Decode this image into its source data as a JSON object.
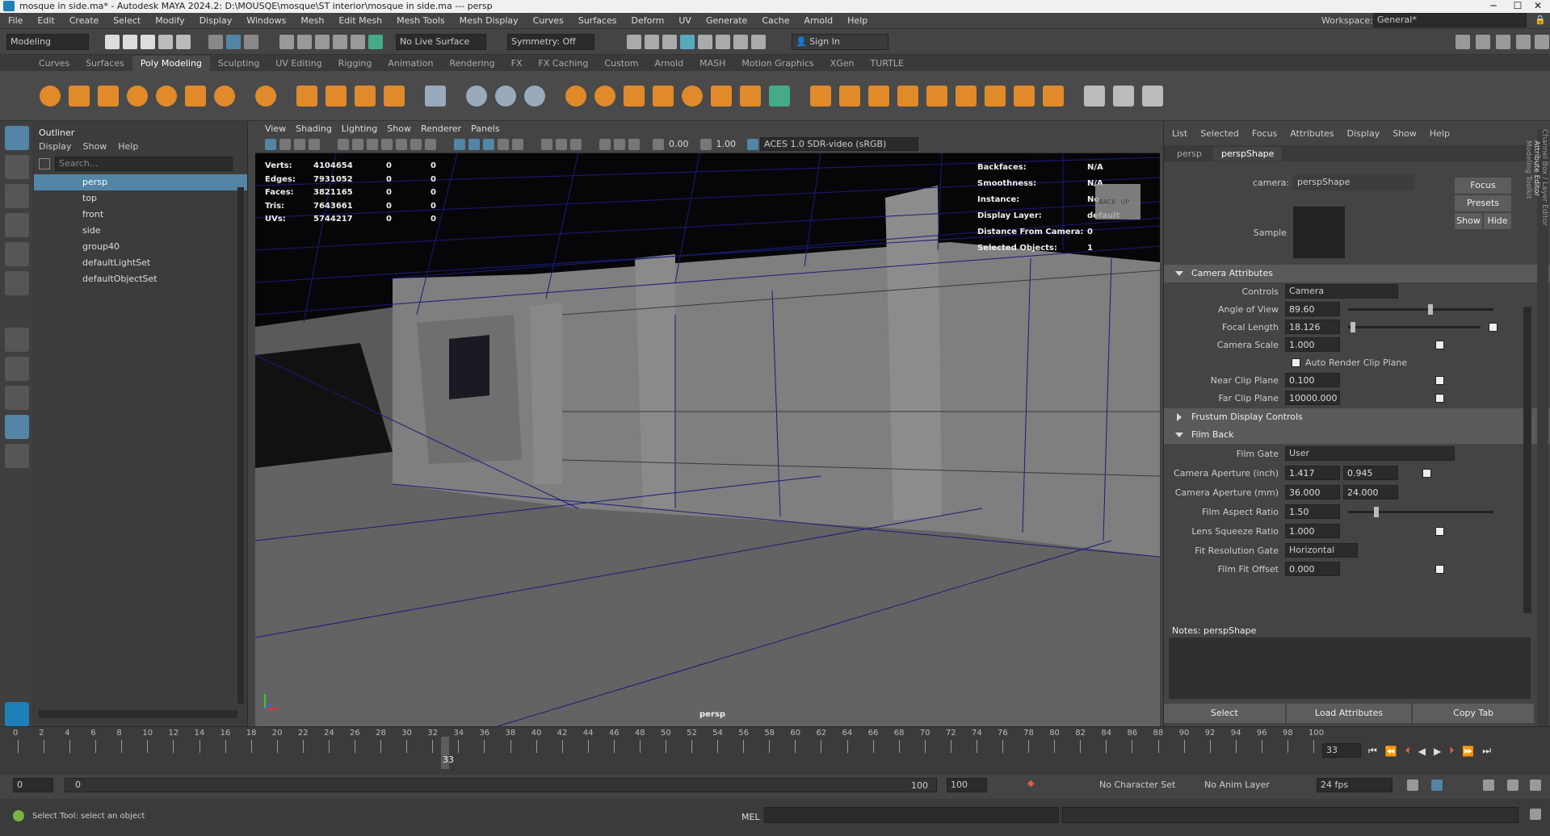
{
  "title": "mosque in side.ma* - Autodesk MAYA 2024.2: D:\\MOUSQE\\mosque\\ST interior\\mosque in side.ma   ---   persp",
  "menus": [
    "File",
    "Edit",
    "Create",
    "Select",
    "Modify",
    "Display",
    "Windows",
    "Mesh",
    "Edit Mesh",
    "Mesh Tools",
    "Mesh Display",
    "Curves",
    "Surfaces",
    "Deform",
    "UV",
    "Generate",
    "Cache",
    "Arnold",
    "Help"
  ],
  "workspace": {
    "label": "Workspace:",
    "value": "General*"
  },
  "status": {
    "mode": "Modeling",
    "live": "No Live Surface",
    "symmetry": "Symmetry: Off",
    "signin": "Sign In"
  },
  "shelf_tabs": [
    "Curves",
    "Surfaces",
    "Poly Modeling",
    "Sculpting",
    "UV Editing",
    "Rigging",
    "Animation",
    "Rendering",
    "FX",
    "FX Caching",
    "Custom",
    "Arnold",
    "MASH",
    "Motion Graphics",
    "XGen",
    "TURTLE"
  ],
  "outliner": {
    "title": "Outliner",
    "menu": [
      "Display",
      "Show",
      "Help"
    ],
    "search": "Search...",
    "items": [
      "persp",
      "top",
      "front",
      "side",
      "group40",
      "defaultLightSet",
      "defaultObjectSet"
    ]
  },
  "viewport": {
    "menu": [
      "View",
      "Shading",
      "Lighting",
      "Show",
      "Renderer",
      "Panels"
    ],
    "val1": "0.00",
    "val2": "1.00",
    "colorspace": "ACES 1.0 SDR-video (sRGB)",
    "camera": "persp",
    "hud_left": [
      [
        "Verts:",
        "4104654",
        "0",
        "0"
      ],
      [
        "Edges:",
        "7931052",
        "0",
        "0"
      ],
      [
        "Faces:",
        "3821165",
        "0",
        "0"
      ],
      [
        "Tris:",
        "7643661",
        "0",
        "0"
      ],
      [
        "UVs:",
        "5744217",
        "0",
        "0"
      ]
    ],
    "hud_right": [
      [
        "Backfaces:",
        "N/A"
      ],
      [
        "Smoothness:",
        "N/A"
      ],
      [
        "Instance:",
        "No"
      ],
      [
        "Display Layer:",
        "default"
      ],
      [
        "Distance From Camera:",
        "0"
      ],
      [
        "Selected Objects:",
        "1"
      ]
    ],
    "cube": [
      "BACK",
      "UP"
    ]
  },
  "ae": {
    "menu": [
      "List",
      "Selected",
      "Focus",
      "Attributes",
      "Display",
      "Show",
      "Help"
    ],
    "tabs": [
      "persp",
      "perspShape"
    ],
    "camera_label": "camera:",
    "camera_value": "perspShape",
    "focus": "Focus",
    "presets": "Presets",
    "show": "Show",
    "hide": "Hide",
    "sample": "Sample",
    "sec_camera": "Camera Attributes",
    "controls_label": "Controls",
    "controls_value": "Camera",
    "aov_label": "Angle of View",
    "aov": "89.60",
    "aov_frac": 0.55,
    "fl_label": "Focal Length",
    "fl": "18.126",
    "fl_frac": 0.02,
    "cs_label": "Camera Scale",
    "cs": "1.000",
    "auto_clip": "Auto Render Clip Plane",
    "near_label": "Near Clip Plane",
    "near": "0.100",
    "far_label": "Far Clip Plane",
    "far": "10000.000",
    "sec_frustum": "Frustum Display Controls",
    "sec_film": "Film Back",
    "fg_label": "Film Gate",
    "fg": "User",
    "ca_in_label": "Camera Aperture (inch)",
    "ca_in_1": "1.417",
    "ca_in_2": "0.945",
    "ca_mm_label": "Camera Aperture (mm)",
    "ca_mm_1": "36.000",
    "ca_mm_2": "24.000",
    "far_ratio_label": "Film Aspect Ratio",
    "far_ratio": "1.50",
    "far_frac": 0.18,
    "lsr_label": "Lens Squeeze Ratio",
    "lsr": "1.000",
    "frg_label": "Fit Resolution Gate",
    "frg": "Horizontal",
    "ffo_label": "Film Fit Offset",
    "ffo": "0.000",
    "notes": "Notes:  perspShape",
    "btn_select": "Select",
    "btn_load": "Load Attributes",
    "btn_copy": "Copy Tab",
    "side_tabs": [
      "Channel Box / Layer Editor",
      "Attribute Editor",
      "Modeling Toolkit"
    ]
  },
  "timeline": {
    "ticks": [
      "0",
      "2",
      "4",
      "6",
      "8",
      "10",
      "12",
      "14",
      "16",
      "18",
      "20",
      "22",
      "24",
      "26",
      "28",
      "30",
      "32",
      "34",
      "36",
      "38",
      "40",
      "42",
      "44",
      "46",
      "48",
      "50",
      "52",
      "54",
      "56",
      "58",
      "60",
      "62",
      "64",
      "66",
      "68",
      "70",
      "72",
      "74",
      "76",
      "78",
      "80",
      "82",
      "84",
      "86",
      "88",
      "90",
      "92",
      "94",
      "96",
      "98",
      "100"
    ],
    "current": "33",
    "current_field": "33"
  },
  "range": {
    "start": "0",
    "inner_start": "0",
    "inner_end": "100",
    "end": "100",
    "char": "No Character Set",
    "anim": "No Anim Layer",
    "fps": "24 fps"
  },
  "cmd": {
    "help": "Select Tool: select an object",
    "lang": "MEL"
  }
}
